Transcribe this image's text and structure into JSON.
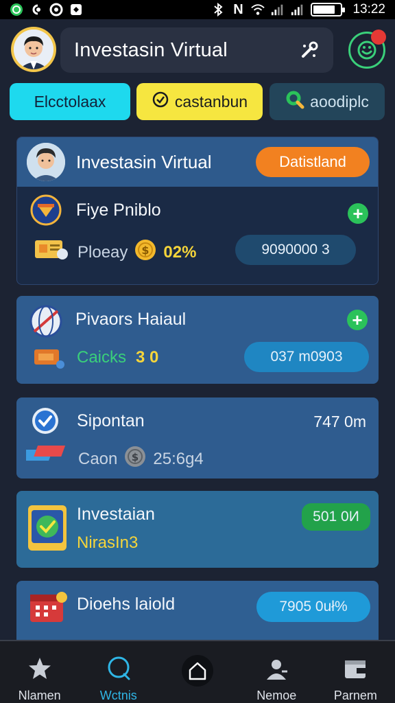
{
  "status_bar": {
    "time": "13:22"
  },
  "header": {
    "title": "Investasin Virtual"
  },
  "filters": [
    {
      "label": "Elcctolaax"
    },
    {
      "label": "castanbun"
    },
    {
      "label": "aoodiplc"
    }
  ],
  "profile_card": {
    "title": "Investasin Virtual",
    "badge": "Datistland",
    "item": {
      "name": "Fiye Pniblo",
      "sub_label": "Ploeay",
      "percent": "02%",
      "value": "9090000 3"
    }
  },
  "cards": [
    {
      "title": "Pivaors Haiaul",
      "sub_label": "Caicks",
      "sub_value": "3 0",
      "value": "037 m0903"
    },
    {
      "title": "Sipontan",
      "right_value": "747 0m",
      "sub_label": "Caon",
      "sub_value": "25:6g4"
    },
    {
      "title": "Investaian",
      "sub_label": "NirasIn3",
      "badge": "501 0И"
    },
    {
      "title": "Dioehs laiold",
      "value": "7905 0uł%"
    }
  ],
  "bottom_nav": [
    {
      "label": "Nlamen",
      "icon": "star-icon"
    },
    {
      "label": "Wctnis",
      "icon": "search-icon",
      "active": true
    },
    {
      "label": "",
      "icon": "home-icon"
    },
    {
      "label": "Nemoe",
      "icon": "profile-icon"
    },
    {
      "label": "Parnem",
      "icon": "wallet-icon"
    }
  ],
  "colors": {
    "background": "#1c2333",
    "accent_green": "#2bc25a",
    "accent_orange": "#f28120",
    "accent_cyan": "#1ed9ee",
    "accent_yellow": "#f6e640"
  }
}
